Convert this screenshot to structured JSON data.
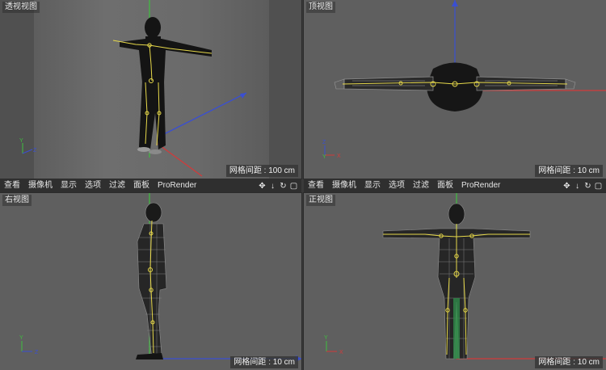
{
  "viewports": {
    "perspective": {
      "title": "透视视图",
      "grid": "网格间距 : 100 cm"
    },
    "top": {
      "title": "顶视图",
      "grid": "网格间距 : 10 cm"
    },
    "right": {
      "title": "右视图",
      "grid": "网格间距 : 10 cm"
    },
    "front": {
      "title": "正视图",
      "grid": "网格间距 : 10 cm"
    }
  },
  "menubar": {
    "items": [
      "查看",
      "摄像机",
      "显示",
      "选项",
      "过滤",
      "面板",
      "ProRender"
    ]
  },
  "axes": {
    "x": "X",
    "y": "Y",
    "z": "Z"
  },
  "icons": [
    "move-icon",
    "down-arrow-icon",
    "rotate-icon",
    "maximize-icon"
  ],
  "colors": {
    "viewport_bg": "#5f5f5f",
    "x_axis": "#d23a3a",
    "y_axis": "#3fbf3f",
    "z_axis": "#3a4fd2",
    "bone": "#e6d84a"
  }
}
